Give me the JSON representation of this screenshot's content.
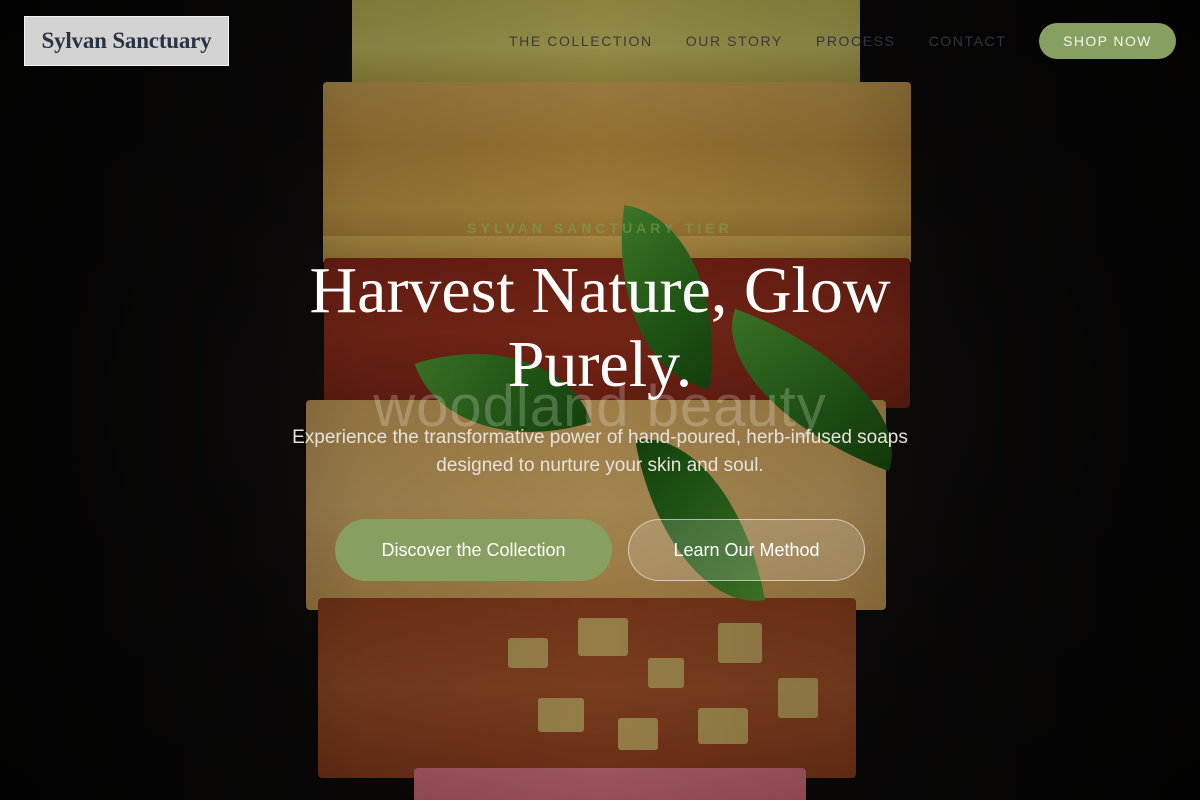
{
  "brand": {
    "name": "Sylvan Sanctuary"
  },
  "nav": {
    "links": [
      {
        "label": "THE COLLECTION"
      },
      {
        "label": "OUR STORY"
      },
      {
        "label": "PROCESS"
      },
      {
        "label": "CONTACT"
      }
    ],
    "cta_label": "SHOP NOW"
  },
  "hero": {
    "eyebrow": "SYLVAN SANCTUARY TIER",
    "title": "Harvest Nature, Glow Purely.",
    "watermark": "woodland beauty",
    "subtitle": "Experience the transformative power of hand-poured, herb-infused soaps designed to nurture your skin and soul.",
    "primary_cta": "Discover the Collection",
    "secondary_cta": "Learn Our Method",
    "image_description": "stacked handmade soap bars with basil leaves"
  },
  "colors": {
    "accent": "#87a061",
    "logo_bg": "#d3d3d3",
    "logo_text": "#2a3344",
    "background": "#0e0c0b"
  }
}
